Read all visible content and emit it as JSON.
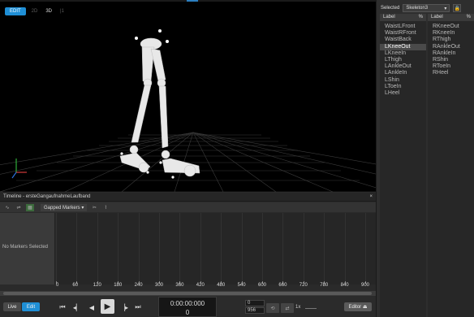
{
  "viewport": {
    "tabs": [
      {
        "label": "EDIT",
        "active": true
      },
      {
        "label": "2D",
        "active": false
      },
      {
        "label": "3D",
        "active": false,
        "strong": true
      },
      {
        "label": "|1",
        "active": false
      }
    ]
  },
  "selected": {
    "label": "Selected",
    "value": "Skeleton3",
    "dropdown_icon": "chevron-down-icon",
    "lock_icon": "lock-icon"
  },
  "label_columns": [
    {
      "header_label": "Label",
      "header_pct": "%",
      "items": [
        "WaistLFront",
        "WaistRFront",
        "WaistBack",
        "LKneeOut",
        "LKneeIn",
        "LThigh",
        "LAnkleOut",
        "LAnkleIn",
        "LShin",
        "LToeIn",
        "LHeel"
      ],
      "highlighted_index": 3
    },
    {
      "header_label": "Label",
      "header_pct": "%",
      "items": [
        "RKneeOut",
        "RKneeIn",
        "RThigh",
        "RAnkleOut",
        "RAnkleIn",
        "RShin",
        "RToeIn",
        "RHeel"
      ],
      "highlighted_index": -1
    }
  ],
  "timeline": {
    "title": "Timeline - ersteGangaufnahmeLaufband",
    "close": "×",
    "gapped_markers": "Gapped Markers ▾",
    "no_markers": "No Markers Selected",
    "ruler_ticks": [
      "0",
      "60",
      "120",
      "180",
      "240",
      "300",
      "360",
      "420",
      "480",
      "540",
      "600",
      "660",
      "720",
      "780",
      "840",
      "900"
    ]
  },
  "transport": {
    "live_label": "Live",
    "edit_label": "Edit",
    "timecode": "0:00:00:000",
    "frame": "0",
    "start_frame": "0",
    "end_frame": "956",
    "speed": "1x",
    "editor_label": "Editor ⏏"
  },
  "colors": {
    "accent": "#1f8fd6",
    "viewport_bg": "#000000",
    "panel_bg": "#2e2e2e"
  }
}
